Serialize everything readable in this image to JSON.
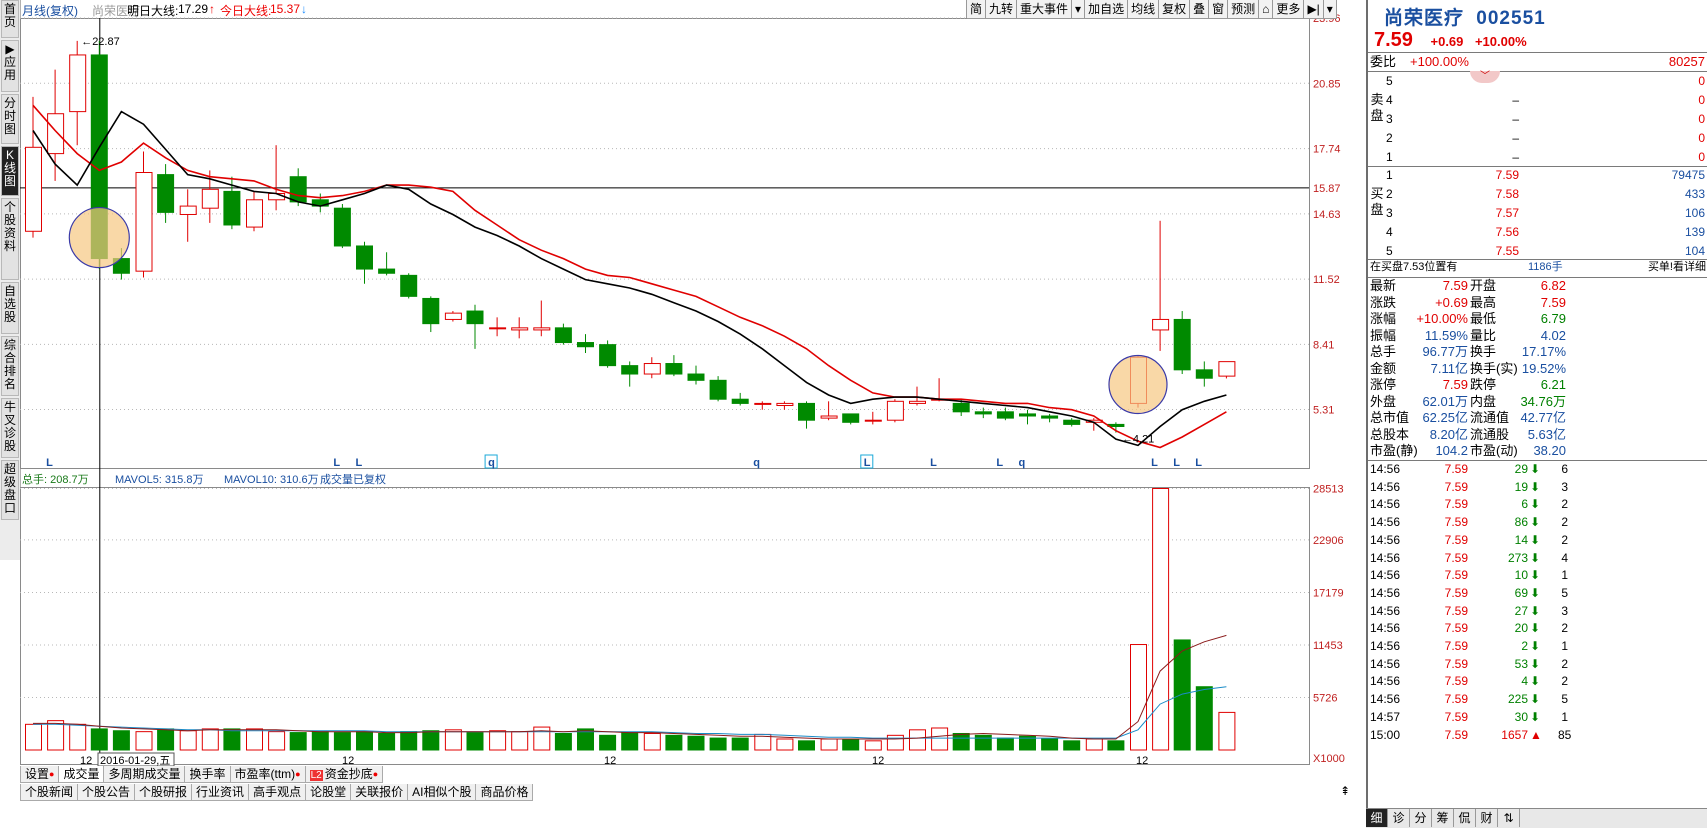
{
  "left_tabs": [
    {
      "label": "首页",
      "active": false
    },
    {
      "label": "▶应用",
      "active": false
    },
    {
      "label": "分时图",
      "active": false
    },
    {
      "label": "K线图",
      "active": true
    },
    {
      "label": "个股资料",
      "active": false
    },
    {
      "label": "自选股",
      "active": false
    },
    {
      "label": "综合排名",
      "active": false
    },
    {
      "label": "牛叉诊股",
      "active": false
    },
    {
      "label": "超级盘口",
      "active": false
    }
  ],
  "header": {
    "period": "月线(复权)",
    "stock": "尚荣医疗",
    "tomorrow_label": "明日大线:",
    "tomorrow_value": "17.29",
    "today_label": "今日大线:",
    "today_value": "15.37"
  },
  "toolbar": [
    "简",
    "九转",
    "重大事件",
    "▾",
    "加自选",
    "均线",
    "复权",
    "叠",
    "窗",
    "预测",
    "⌂",
    "更多",
    "▶|",
    "▾"
  ],
  "chart": {
    "price_axis": [
      "23.96",
      "20.85",
      "17.74",
      "15.87",
      "14.63",
      "11.52",
      "8.41",
      "5.31"
    ],
    "high_label": "22.87",
    "low_label": "4.21",
    "markers": [
      {
        "text": "L",
        "boxed": false
      },
      {
        "text": "L",
        "boxed": false
      },
      {
        "text": "L",
        "boxed": false
      },
      {
        "text": "q",
        "boxed": true
      },
      {
        "text": "q",
        "boxed": false
      },
      {
        "text": "L",
        "boxed": true
      },
      {
        "text": "L",
        "boxed": false
      },
      {
        "text": "L",
        "boxed": false
      },
      {
        "text": "q",
        "boxed": false
      },
      {
        "text": "L",
        "boxed": false
      },
      {
        "text": "L",
        "boxed": false
      },
      {
        "text": "L",
        "boxed": false
      }
    ],
    "candles": [
      {
        "o": 13.8,
        "c": 17.8,
        "h": 20.2,
        "l": 13.5
      },
      {
        "o": 17.5,
        "c": 19.4,
        "h": 21.5,
        "l": 16.2
      },
      {
        "o": 19.5,
        "c": 22.2,
        "h": 22.87,
        "l": 17.9
      },
      {
        "o": 22.2,
        "c": 12.5,
        "h": 22.87,
        "l": 12.0
      },
      {
        "o": 12.5,
        "c": 11.8,
        "h": 13.0,
        "l": 11.5
      },
      {
        "o": 11.9,
        "c": 16.6,
        "h": 17.6,
        "l": 11.6
      },
      {
        "o": 16.5,
        "c": 14.7,
        "h": 17.0,
        "l": 14.2
      },
      {
        "o": 14.6,
        "c": 15.0,
        "h": 15.8,
        "l": 13.3
      },
      {
        "o": 14.9,
        "c": 15.8,
        "h": 16.7,
        "l": 14.2
      },
      {
        "o": 15.7,
        "c": 14.1,
        "h": 16.4,
        "l": 13.9
      },
      {
        "o": 14.0,
        "c": 15.3,
        "h": 15.7,
        "l": 13.8
      },
      {
        "o": 15.3,
        "c": 15.6,
        "h": 17.9,
        "l": 14.8
      },
      {
        "o": 16.4,
        "c": 15.2,
        "h": 16.8,
        "l": 15.0
      },
      {
        "o": 15.3,
        "c": 15.0,
        "h": 15.6,
        "l": 14.7
      },
      {
        "o": 14.9,
        "c": 13.1,
        "h": 15.1,
        "l": 13.0
      },
      {
        "o": 13.1,
        "c": 12.0,
        "h": 13.3,
        "l": 11.3
      },
      {
        "o": 12.0,
        "c": 11.8,
        "h": 12.8,
        "l": 11.7
      },
      {
        "o": 11.7,
        "c": 10.7,
        "h": 11.8,
        "l": 10.6
      },
      {
        "o": 10.6,
        "c": 9.4,
        "h": 10.7,
        "l": 9.0
      },
      {
        "o": 9.6,
        "c": 9.9,
        "h": 10.0,
        "l": 9.5
      },
      {
        "o": 10.0,
        "c": 9.4,
        "h": 10.3,
        "l": 8.2
      },
      {
        "o": 9.2,
        "c": 9.2,
        "h": 9.7,
        "l": 8.8
      },
      {
        "o": 9.1,
        "c": 9.2,
        "h": 9.7,
        "l": 8.7
      },
      {
        "o": 9.1,
        "c": 9.2,
        "h": 10.5,
        "l": 8.8
      },
      {
        "o": 9.2,
        "c": 8.5,
        "h": 9.4,
        "l": 8.4
      },
      {
        "o": 8.5,
        "c": 8.3,
        "h": 8.9,
        "l": 8.0
      },
      {
        "o": 8.4,
        "c": 7.4,
        "h": 8.6,
        "l": 7.3
      },
      {
        "o": 7.4,
        "c": 7.0,
        "h": 7.6,
        "l": 6.4
      },
      {
        "o": 7.0,
        "c": 7.5,
        "h": 7.8,
        "l": 6.8
      },
      {
        "o": 7.5,
        "c": 7.0,
        "h": 7.9,
        "l": 6.9
      },
      {
        "o": 7.0,
        "c": 6.7,
        "h": 7.4,
        "l": 6.5
      },
      {
        "o": 6.7,
        "c": 5.8,
        "h": 6.9,
        "l": 5.7
      },
      {
        "o": 5.8,
        "c": 5.6,
        "h": 6.1,
        "l": 5.5
      },
      {
        "o": 5.6,
        "c": 5.6,
        "h": 5.7,
        "l": 5.3
      },
      {
        "o": 5.5,
        "c": 5.6,
        "h": 5.7,
        "l": 5.3
      },
      {
        "o": 5.6,
        "c": 4.8,
        "h": 5.7,
        "l": 4.4
      },
      {
        "o": 4.9,
        "c": 5.0,
        "h": 5.7,
        "l": 4.8
      },
      {
        "o": 5.1,
        "c": 4.7,
        "h": 5.1,
        "l": 4.6
      },
      {
        "o": 4.8,
        "c": 4.8,
        "h": 5.2,
        "l": 4.6
      },
      {
        "o": 4.8,
        "c": 5.7,
        "h": 5.8,
        "l": 4.7
      },
      {
        "o": 5.6,
        "c": 5.7,
        "h": 6.4,
        "l": 5.5
      },
      {
        "o": 5.8,
        "c": 5.8,
        "h": 6.8,
        "l": 5.7
      },
      {
        "o": 5.6,
        "c": 5.2,
        "h": 5.8,
        "l": 5.0
      },
      {
        "o": 5.2,
        "c": 5.1,
        "h": 5.4,
        "l": 4.9
      },
      {
        "o": 5.2,
        "c": 4.9,
        "h": 5.4,
        "l": 4.8
      },
      {
        "o": 5.1,
        "c": 5.0,
        "h": 5.3,
        "l": 4.6
      },
      {
        "o": 5.0,
        "c": 4.9,
        "h": 5.1,
        "l": 4.7
      },
      {
        "o": 4.8,
        "c": 4.6,
        "h": 4.9,
        "l": 4.5
      },
      {
        "o": 4.7,
        "c": 4.8,
        "h": 4.9,
        "l": 4.3
      },
      {
        "o": 4.6,
        "c": 4.5,
        "h": 4.7,
        "l": 4.21
      },
      {
        "o": 5.6,
        "c": 7.8,
        "h": 7.9,
        "l": 5.4
      },
      {
        "o": 9.1,
        "c": 9.6,
        "h": 14.3,
        "l": 8.1
      },
      {
        "o": 9.6,
        "c": 7.2,
        "h": 10.0,
        "l": 7.0
      },
      {
        "o": 7.2,
        "c": 6.8,
        "h": 7.6,
        "l": 6.4
      },
      {
        "o": 6.9,
        "c": 7.59,
        "h": 7.59,
        "l": 6.79
      }
    ],
    "ma5": [
      18.6,
      17.0,
      16.0,
      17.8,
      19.5,
      18.9,
      17.7,
      16.5,
      16.3,
      16.0,
      15.7,
      15.6,
      15.2,
      15.0,
      15.3,
      15.6,
      16.0,
      15.8,
      15.1,
      14.6,
      14.0,
      13.6,
      13.1,
      12.5,
      12.0,
      11.5,
      11.3,
      11.1,
      10.8,
      10.4,
      10.0,
      9.5,
      8.9,
      8.2,
      7.4,
      6.6,
      6.0,
      5.6,
      5.8,
      5.9,
      5.9,
      5.8,
      5.7,
      5.6,
      5.5,
      5.4,
      5.2,
      5.0,
      4.7,
      3.9,
      3.6,
      4.5,
      5.3,
      5.7,
      6.0
    ],
    "ma10": [
      19.8,
      18.6,
      17.5,
      16.7,
      17.1,
      18.0,
      17.3,
      16.7,
      16.4,
      16.3,
      16.2,
      15.8,
      15.5,
      15.4,
      15.5,
      15.7,
      16.0,
      16.0,
      15.9,
      15.7,
      14.8,
      14.1,
      13.4,
      12.9,
      12.5,
      12.0,
      11.7,
      11.6,
      11.3,
      11.0,
      10.7,
      10.2,
      9.7,
      9.3,
      8.8,
      8.2,
      7.4,
      6.7,
      6.1,
      5.9,
      5.9,
      5.8,
      5.8,
      5.7,
      5.6,
      5.6,
      5.4,
      5.3,
      5.0,
      4.3,
      3.8,
      3.5,
      4.0,
      4.6,
      5.2
    ],
    "x_labels": [
      "12",
      "2016-01-29,五",
      "12",
      "12",
      "12",
      "12"
    ],
    "volume_header": {
      "vol_label": "总手: 208.7万",
      "mavol5_label": "MAVOL5: 315.8万",
      "mavol10_label": "MAVOL10: 310.6万",
      "note": "成交量已复权"
    },
    "volume_axis": [
      "28513",
      "22906",
      "17179",
      "11453",
      "5726",
      "X1000"
    ],
    "volumes": [
      2800,
      3200,
      2800,
      2300,
      2100,
      2000,
      2300,
      2100,
      2300,
      2300,
      2300,
      2000,
      1900,
      2000,
      1900,
      2000,
      1800,
      2000,
      2100,
      2200,
      1900,
      2100,
      2000,
      2500,
      1800,
      2300,
      1600,
      1900,
      1800,
      1600,
      1500,
      1300,
      1300,
      1700,
      1200,
      1000,
      1200,
      1100,
      1000,
      1600,
      2200,
      2400,
      1800,
      1600,
      1300,
      1500,
      1200,
      1000,
      1200,
      1000,
      11500,
      28513,
      12000,
      6900,
      4100
    ],
    "mavol5": [
      2900,
      2900,
      2800,
      2600,
      2400,
      2300,
      2200,
      2100,
      2200,
      2200,
      2200,
      2200,
      2100,
      2000,
      2000,
      2000,
      1900,
      1900,
      2000,
      2000,
      2000,
      2000,
      2000,
      2100,
      2000,
      2100,
      2000,
      1900,
      1900,
      1800,
      1700,
      1600,
      1500,
      1500,
      1400,
      1300,
      1200,
      1200,
      1200,
      1200,
      1300,
      1500,
      1700,
      1800,
      1700,
      1600,
      1500,
      1300,
      1200,
      1200,
      3100,
      8600,
      10800,
      11800,
      12500
    ],
    "mavol10": [
      2800,
      2800,
      2700,
      2600,
      2500,
      2400,
      2300,
      2200,
      2200,
      2100,
      2100,
      2100,
      2100,
      2100,
      2100,
      2100,
      2000,
      2000,
      2000,
      2000,
      2000,
      2000,
      2000,
      2000,
      2000,
      2000,
      2000,
      2000,
      2000,
      1900,
      1800,
      1800,
      1700,
      1700,
      1600,
      1500,
      1400,
      1400,
      1300,
      1300,
      1300,
      1300,
      1300,
      1300,
      1300,
      1300,
      1300,
      1300,
      1300,
      1300,
      2200,
      5000,
      6100,
      6600,
      6900
    ]
  },
  "bottom_tabs_1": [
    {
      "label": "设置",
      "dot": true,
      "active": false
    },
    {
      "label": "成交量",
      "dot": false,
      "active": true
    },
    {
      "label": "多周期成交量",
      "dot": false,
      "active": false
    },
    {
      "label": "换手率",
      "dot": false,
      "active": false
    },
    {
      "label": "市盈率(ttm)",
      "dot": true,
      "active": false
    },
    {
      "label": "资金抄底",
      "dot": true,
      "active": false,
      "badge": "L2"
    }
  ],
  "bottom_tabs_2": [
    "个股新闻",
    "个股公告",
    "个股研报",
    "行业资讯",
    "高手观点",
    "论股堂",
    "关联报价",
    "AI相似个股",
    "商品价格"
  ],
  "right": {
    "name": "尚荣医疗",
    "code": "002551",
    "price": "7.59",
    "change": "+0.69",
    "change_pct": "+10.00%",
    "weibi_label": "委比",
    "weibi_pct": "+100.00%",
    "weibi_vol": "80257",
    "sell_label": "卖盘",
    "buy_label": "买盘",
    "sell": [
      {
        "lvl": "5",
        "price": "",
        "vol": "0"
      },
      {
        "lvl": "4",
        "price": "–",
        "vol": "0"
      },
      {
        "lvl": "3",
        "price": "–",
        "vol": "0"
      },
      {
        "lvl": "2",
        "price": "–",
        "vol": "0"
      },
      {
        "lvl": "1",
        "price": "–",
        "vol": "0"
      }
    ],
    "buy": [
      {
        "lvl": "1",
        "price": "7.59",
        "vol": "79475"
      },
      {
        "lvl": "2",
        "price": "7.58",
        "vol": "433"
      },
      {
        "lvl": "3",
        "price": "7.57",
        "vol": "106"
      },
      {
        "lvl": "4",
        "price": "7.56",
        "vol": "139"
      },
      {
        "lvl": "5",
        "price": "7.55",
        "vol": "104"
      }
    ],
    "zaimai_text": "在买盘7.53位置有",
    "zaimai_vol": "1186手",
    "zaimai_link": "买单!看详细",
    "stats": [
      [
        "最新",
        "7.59",
        "开盘",
        "6.82"
      ],
      [
        "涨跌",
        "+0.69",
        "最高",
        "7.59"
      ],
      [
        "涨幅",
        "+10.00%",
        "最低",
        "6.79"
      ],
      [
        "振幅",
        "11.59%",
        "量比",
        "4.02"
      ],
      [
        "总手",
        "96.77万",
        "换手",
        "17.17%"
      ],
      [
        "金额",
        "7.11亿",
        "换手(实)",
        "19.52%"
      ],
      [
        "涨停",
        "7.59",
        "跌停",
        "6.21"
      ],
      [
        "外盘",
        "62.01万",
        "内盘",
        "34.76万"
      ],
      [
        "总市值",
        "62.25亿",
        "流通值",
        "42.77亿"
      ],
      [
        "总股本",
        "8.20亿",
        "流通股",
        "5.63亿"
      ],
      [
        "市盈(静)",
        "104.2",
        "市盈(动)",
        "38.20"
      ]
    ],
    "ticks": [
      {
        "t": "14:56",
        "p": "7.59",
        "v": "29",
        "d": "down",
        "n": "6"
      },
      {
        "t": "14:56",
        "p": "7.59",
        "v": "19",
        "d": "down",
        "n": "3"
      },
      {
        "t": "14:56",
        "p": "7.59",
        "v": "6",
        "d": "down",
        "n": "2"
      },
      {
        "t": "14:56",
        "p": "7.59",
        "v": "86",
        "d": "down",
        "n": "2"
      },
      {
        "t": "14:56",
        "p": "7.59",
        "v": "14",
        "d": "down",
        "n": "2"
      },
      {
        "t": "14:56",
        "p": "7.59",
        "v": "273",
        "d": "down",
        "n": "4"
      },
      {
        "t": "14:56",
        "p": "7.59",
        "v": "10",
        "d": "down",
        "n": "1"
      },
      {
        "t": "14:56",
        "p": "7.59",
        "v": "69",
        "d": "down",
        "n": "5"
      },
      {
        "t": "14:56",
        "p": "7.59",
        "v": "27",
        "d": "down",
        "n": "3"
      },
      {
        "t": "14:56",
        "p": "7.59",
        "v": "20",
        "d": "down",
        "n": "2"
      },
      {
        "t": "14:56",
        "p": "7.59",
        "v": "2",
        "d": "down",
        "n": "1"
      },
      {
        "t": "14:56",
        "p": "7.59",
        "v": "53",
        "d": "down",
        "n": "2"
      },
      {
        "t": "14:56",
        "p": "7.59",
        "v": "4",
        "d": "down",
        "n": "2"
      },
      {
        "t": "14:56",
        "p": "7.59",
        "v": "225",
        "d": "down",
        "n": "5"
      },
      {
        "t": "14:57",
        "p": "7.59",
        "v": "30",
        "d": "down",
        "n": "1"
      },
      {
        "t": "15:00",
        "p": "7.59",
        "v": "1657",
        "d": "up",
        "n": "85"
      }
    ],
    "bottom_tabs": [
      "细",
      "诊",
      "分",
      "筹",
      "侃",
      "财",
      "⇅"
    ],
    "bottom_active": 0
  }
}
